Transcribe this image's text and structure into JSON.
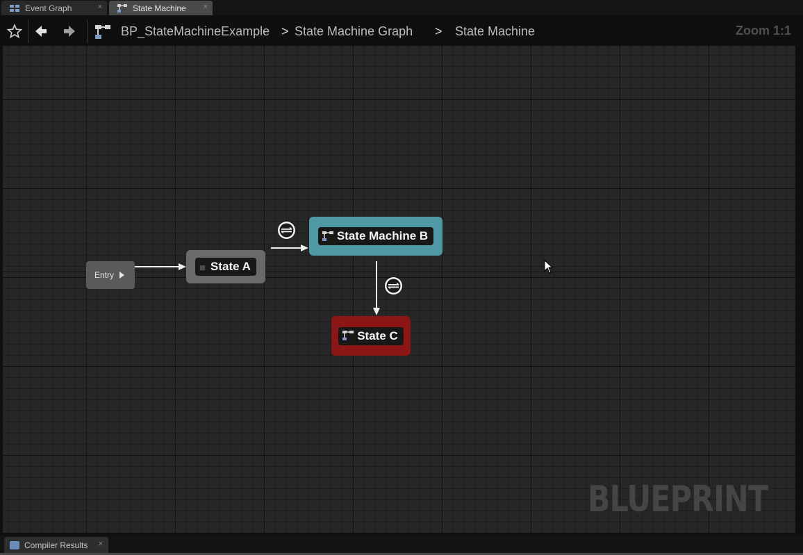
{
  "tabs": [
    {
      "label": "Event Graph",
      "close": "×",
      "icon": "event-graph-icon",
      "active": false
    },
    {
      "label": "State Machine",
      "close": "×",
      "icon": "state-machine-icon",
      "active": true
    }
  ],
  "toolbar": {
    "favorite_icon": "star-icon",
    "back_icon": "back-arrow-icon",
    "forward_icon": "forward-arrow-icon"
  },
  "breadcrumb": {
    "items": [
      "BP_StateMachineExample",
      "State Machine Graph",
      "State Machine"
    ],
    "separator": ">"
  },
  "zoom_label": "Zoom 1:1",
  "graph": {
    "entry_label": "Entry",
    "nodes": [
      {
        "label": "State A",
        "kind": "state",
        "color": "#6a6a6a"
      },
      {
        "label": "State Machine B",
        "kind": "state-machine",
        "color": "#4f99a4"
      },
      {
        "label": "State C",
        "kind": "state-machine",
        "color": "#8c1515"
      }
    ],
    "transitions": [
      {
        "from": "Entry",
        "to": "State A"
      },
      {
        "from": "State A",
        "to": "State Machine B",
        "rule_icon": "transition-rule-icon"
      },
      {
        "from": "State Machine B",
        "to": "State C",
        "rule_icon": "transition-rule-icon"
      }
    ]
  },
  "watermark": "BLUEPRINT",
  "bottom_panel": {
    "tab_label": "Compiler Results",
    "close": "×",
    "icon": "compiler-results-icon"
  }
}
